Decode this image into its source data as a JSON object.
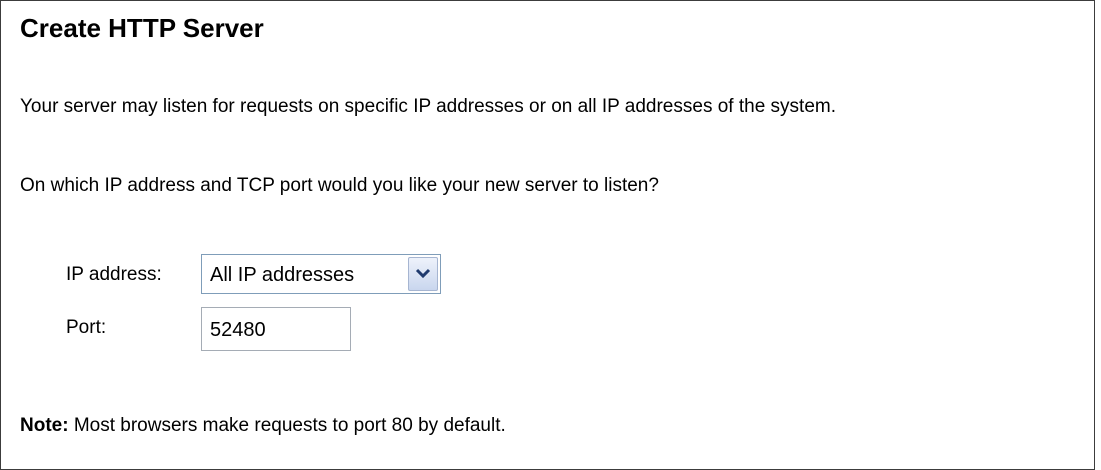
{
  "page": {
    "title": "Create HTTP Server",
    "intro": "Your server may listen for requests on specific IP addresses or on all IP addresses of the system.",
    "question": "On which IP address and TCP port would you like your new server to listen?"
  },
  "form": {
    "ip_label": "IP address:",
    "ip_selected": "All IP addresses",
    "port_label": "Port:",
    "port_value": "52480"
  },
  "note": {
    "label": "Note:",
    "text": " Most browsers make requests to port 80 by default."
  },
  "icons": {
    "dropdown": "chevron-down-icon"
  },
  "colors": {
    "frame_border": "#3c3c3c",
    "select_border": "#7f9db9",
    "input_border": "#a5acb5"
  }
}
